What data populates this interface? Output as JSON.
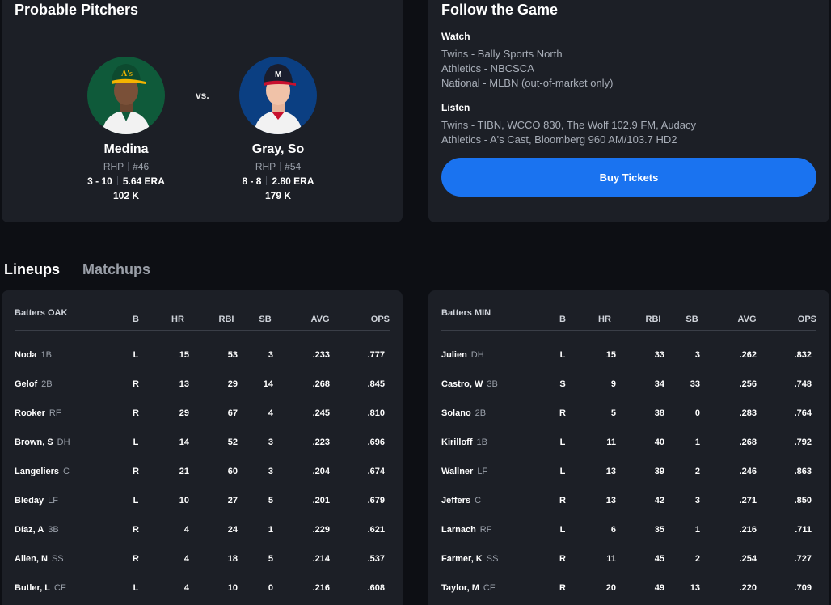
{
  "probable_pitchers": {
    "title": "Probable Pitchers",
    "vs_label": "vs.",
    "away": {
      "name": "Medina",
      "throws": "RHP",
      "number": "#46",
      "record": "3 - 10",
      "era": "5.64 ERA",
      "strikeouts": "102 K",
      "team_color": "#0f5a3a"
    },
    "home": {
      "name": "Gray, So",
      "throws": "RHP",
      "number": "#54",
      "record": "8 - 8",
      "era": "2.80 ERA",
      "strikeouts": "179 K",
      "team_color": "#0b3f82"
    }
  },
  "follow_the_game": {
    "title": "Follow the Game",
    "watch_label": "Watch",
    "watch": [
      "Twins - Bally Sports North",
      "Athletics - NBCSCA",
      "National - MLBN (out-of-market only)"
    ],
    "listen_label": "Listen",
    "listen": [
      "Twins - TIBN, WCCO 830, The Wolf 102.9 FM, Audacy",
      "Athletics - A's Cast, Bloomberg 960 AM/103.7 HD2"
    ],
    "buy_tickets_label": "Buy Tickets",
    "accent_color": "#1a73f0"
  },
  "tabs": [
    {
      "label": "Lineups",
      "active": true
    },
    {
      "label": "Matchups",
      "active": false
    }
  ],
  "columns": [
    "B",
    "HR",
    "RBI",
    "SB",
    "AVG",
    "OPS"
  ],
  "oak": {
    "header": "Batters OAK",
    "rows": [
      {
        "name": "Noda",
        "pos": "1B",
        "b": "L",
        "hr": "15",
        "rbi": "53",
        "sb": "3",
        "avg": ".233",
        "ops": ".777"
      },
      {
        "name": "Gelof",
        "pos": "2B",
        "b": "R",
        "hr": "13",
        "rbi": "29",
        "sb": "14",
        "avg": ".268",
        "ops": ".845"
      },
      {
        "name": "Rooker",
        "pos": "RF",
        "b": "R",
        "hr": "29",
        "rbi": "67",
        "sb": "4",
        "avg": ".245",
        "ops": ".810"
      },
      {
        "name": "Brown, S",
        "pos": "DH",
        "b": "L",
        "hr": "14",
        "rbi": "52",
        "sb": "3",
        "avg": ".223",
        "ops": ".696"
      },
      {
        "name": "Langeliers",
        "pos": "C",
        "b": "R",
        "hr": "21",
        "rbi": "60",
        "sb": "3",
        "avg": ".204",
        "ops": ".674"
      },
      {
        "name": "Bleday",
        "pos": "LF",
        "b": "L",
        "hr": "10",
        "rbi": "27",
        "sb": "5",
        "avg": ".201",
        "ops": ".679"
      },
      {
        "name": "Díaz, A",
        "pos": "3B",
        "b": "R",
        "hr": "4",
        "rbi": "24",
        "sb": "1",
        "avg": ".229",
        "ops": ".621"
      },
      {
        "name": "Allen, N",
        "pos": "SS",
        "b": "R",
        "hr": "4",
        "rbi": "18",
        "sb": "5",
        "avg": ".214",
        "ops": ".537"
      },
      {
        "name": "Butler, L",
        "pos": "CF",
        "b": "L",
        "hr": "4",
        "rbi": "10",
        "sb": "0",
        "avg": ".216",
        "ops": ".608"
      }
    ]
  },
  "min": {
    "header": "Batters MIN",
    "rows": [
      {
        "name": "Julien",
        "pos": "DH",
        "b": "L",
        "hr": "15",
        "rbi": "33",
        "sb": "3",
        "avg": ".262",
        "ops": ".832"
      },
      {
        "name": "Castro, W",
        "pos": "3B",
        "b": "S",
        "hr": "9",
        "rbi": "34",
        "sb": "33",
        "avg": ".256",
        "ops": ".748"
      },
      {
        "name": "Solano",
        "pos": "2B",
        "b": "R",
        "hr": "5",
        "rbi": "38",
        "sb": "0",
        "avg": ".283",
        "ops": ".764"
      },
      {
        "name": "Kirilloff",
        "pos": "1B",
        "b": "L",
        "hr": "11",
        "rbi": "40",
        "sb": "1",
        "avg": ".268",
        "ops": ".792"
      },
      {
        "name": "Wallner",
        "pos": "LF",
        "b": "L",
        "hr": "13",
        "rbi": "39",
        "sb": "2",
        "avg": ".246",
        "ops": ".863"
      },
      {
        "name": "Jeffers",
        "pos": "C",
        "b": "R",
        "hr": "13",
        "rbi": "42",
        "sb": "3",
        "avg": ".271",
        "ops": ".850"
      },
      {
        "name": "Larnach",
        "pos": "RF",
        "b": "L",
        "hr": "6",
        "rbi": "35",
        "sb": "1",
        "avg": ".216",
        "ops": ".711"
      },
      {
        "name": "Farmer, K",
        "pos": "SS",
        "b": "R",
        "hr": "11",
        "rbi": "45",
        "sb": "2",
        "avg": ".254",
        "ops": ".727"
      },
      {
        "name": "Taylor, M",
        "pos": "CF",
        "b": "R",
        "hr": "20",
        "rbi": "49",
        "sb": "13",
        "avg": ".220",
        "ops": ".709"
      }
    ]
  }
}
